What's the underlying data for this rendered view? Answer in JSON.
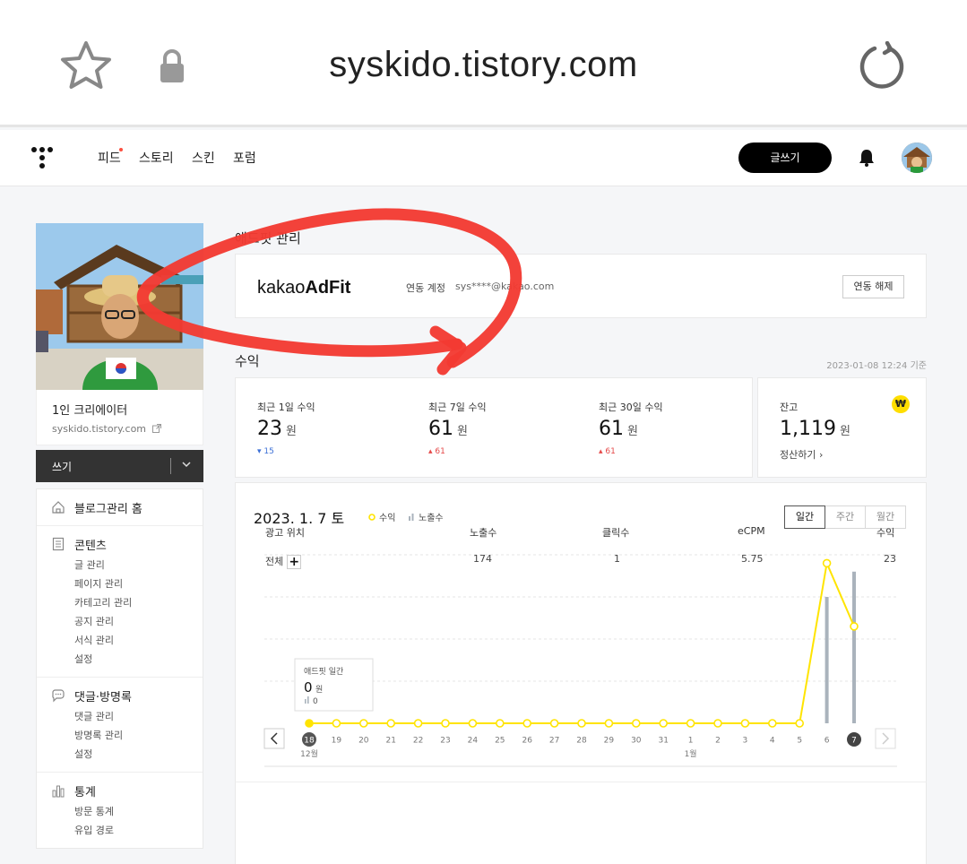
{
  "browser": {
    "url": "syskido.tistory.com",
    "icons": {
      "bookmark": "star-icon",
      "secure": "lock-icon",
      "reload": "reload-icon"
    }
  },
  "topnav": {
    "items": [
      "피드",
      "스토리",
      "스킨",
      "포럼"
    ],
    "write_button": "글쓰기"
  },
  "sidebar": {
    "blog_name": "1인 크리에이터",
    "blog_url": "syskido.tistory.com",
    "write_label": "쓰기",
    "sections": [
      {
        "title": "블로그관리 홈",
        "icon": "home-icon",
        "items": []
      },
      {
        "title": "콘텐츠",
        "icon": "document-icon",
        "items": [
          "글 관리",
          "페이지 관리",
          "카테고리 관리",
          "공지 관리",
          "서식 관리",
          "설정"
        ]
      },
      {
        "title": "댓글·방명록",
        "icon": "speech-bubble-icon",
        "items": [
          "댓글 관리",
          "방명록 관리",
          "설정"
        ]
      },
      {
        "title": "통계",
        "icon": "bar-chart-icon",
        "items": [
          "방문 통계",
          "유입 경로"
        ]
      }
    ]
  },
  "adfit": {
    "section_title": "애드핏 관리",
    "logo_light": "kakao",
    "logo_bold": "AdFit",
    "linked_label": "연동 계정",
    "linked_email": "sys****@kakao.com",
    "unlink_button": "연동 해제"
  },
  "revenue": {
    "section_title": "수익",
    "as_of": "2023-01-08 12:24 기준",
    "unit": "원",
    "stats": [
      {
        "label": "최근 1일 수익",
        "value": "23",
        "delta": "15",
        "direction": "down"
      },
      {
        "label": "최근 7일 수익",
        "value": "61",
        "delta": "61",
        "direction": "up"
      },
      {
        "label": "최근 30일 수익",
        "value": "61",
        "delta": "61",
        "direction": "up"
      }
    ],
    "balance": {
      "label": "잔고",
      "value": "1,119",
      "badge": "₩",
      "settle": "정산하기"
    }
  },
  "chart_panel": {
    "date_label": "2023. 1. 7 토",
    "legend_revenue": "수익",
    "legend_impressions": "노출수",
    "periods": [
      "일간",
      "주간",
      "월간"
    ],
    "active_period": "일간",
    "tooltip": {
      "title": "애드핏 일간",
      "value": "0",
      "unit": "원",
      "impressions": "0"
    }
  },
  "chart_data": {
    "type": "line",
    "categories": [
      "18",
      "19",
      "20",
      "21",
      "22",
      "23",
      "24",
      "25",
      "26",
      "27",
      "28",
      "29",
      "30",
      "31",
      "1",
      "2",
      "3",
      "4",
      "5",
      "6",
      "7"
    ],
    "month_labels": [
      {
        "index": 0,
        "label": "12월"
      },
      {
        "index": 14,
        "label": "1월"
      }
    ],
    "selected_index": 0,
    "highlighted_index": 20,
    "series": [
      {
        "name": "수익",
        "type": "line",
        "color": "#ffe400",
        "values": [
          0,
          0,
          0,
          0,
          0,
          0,
          0,
          0,
          0,
          0,
          0,
          0,
          0,
          0,
          0,
          0,
          0,
          0,
          0,
          38,
          23
        ]
      },
      {
        "name": "노출수",
        "type": "bar",
        "color": "#aab3bc",
        "values": [
          0,
          0,
          0,
          0,
          0,
          0,
          0,
          0,
          0,
          0,
          0,
          0,
          0,
          0,
          0,
          0,
          0,
          0,
          0,
          300,
          360
        ]
      }
    ],
    "revenue_max": 40,
    "impressions_max": 400
  },
  "table": {
    "headers": [
      "광고 위치",
      "노출수",
      "클릭수",
      "eCPM",
      "수익"
    ],
    "row": {
      "name": "전체",
      "impressions": "174",
      "clicks": "1",
      "ecpm": "5.75",
      "revenue": "23"
    }
  }
}
